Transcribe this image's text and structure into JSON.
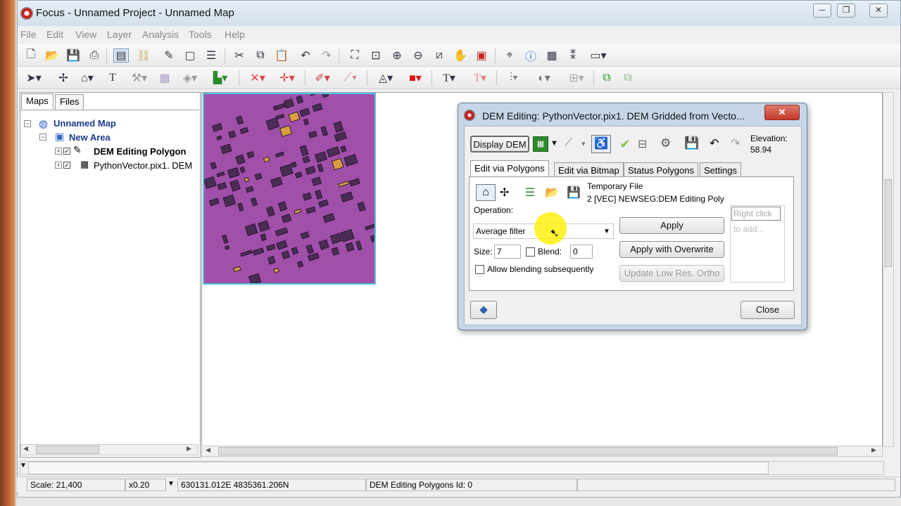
{
  "window": {
    "title": "Focus - Unnamed Project - Unnamed Map"
  },
  "menu": [
    "File",
    "Edit",
    "View",
    "Layer",
    "Analysis",
    "Tools",
    "Help"
  ],
  "left_panel": {
    "tabs": [
      "Maps",
      "Files"
    ],
    "tree": {
      "map": "Unnamed Map",
      "area": "New Area",
      "layer1": "DEM Editing Polygon",
      "layer2": "PythonVector.pix1. DEM"
    }
  },
  "dialog": {
    "title": "DEM Editing: PythonVector.pix1. DEM Gridded from Vecto...",
    "close_glyph": "✕",
    "display_dem": "Display DEM",
    "elevation_label": "Elevation:",
    "elevation_value": "58.94",
    "tabs": [
      "Edit via Polygons",
      "Edit via Bitmap",
      "Status Polygons",
      "Settings"
    ],
    "temporary_file_label": "Temporary File",
    "temporary_file_value": "2 [VEC] NEWSEG:DEM Editing Poly",
    "operation_label": "Operation:",
    "operation_value": "Average filter",
    "size_label": "Size:",
    "size_value": "7",
    "blend_label": "Blend:",
    "blend_value": "0",
    "allow_blending": "Allow blending subsequently",
    "apply": "Apply",
    "apply_overwrite": "Apply with Overwrite",
    "update_ortho": "Update Low Res. Ortho",
    "hint_line1": "Right click",
    "hint_line2": "to add...",
    "close": "Close"
  },
  "status": {
    "scale": "Scale: 21,400",
    "zoom": "x0.20",
    "coords": "630131.012E 4835361.206N",
    "layer": "DEM Editing Polygons  Id: 0"
  },
  "colors": {
    "dem_fill": "#a050a8",
    "selection_outline": "#4fc3e6",
    "cursor_highlight": "#fff000"
  }
}
